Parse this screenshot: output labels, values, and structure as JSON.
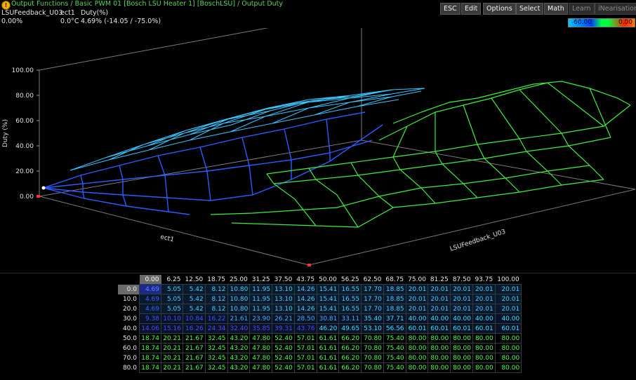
{
  "header": {
    "title": "Output Functions / Basic PWM 01 [Bosch LSU Heater 1] [BoschLSU] / Output Duty",
    "x_name": "LSUFeedback_U03",
    "x_value": "0.00%",
    "y_name": "ect1",
    "y_value": "0.0°C",
    "z_name": "Duty(%)",
    "z_value": "4.69% (-14.05 / -75.0%)"
  },
  "toolbar": {
    "esc": "ESC",
    "edit": "Edit",
    "options": "Options",
    "select": "Select",
    "math": "Math",
    "learn": "Learn",
    "linearisation": "iNearisation"
  },
  "scale": {
    "low": "-60.00",
    "high": "0.00"
  },
  "plot": {
    "z_axis_title": "Duty (%)",
    "z_ticks": [
      "100.00",
      "80.00",
      "60.00",
      "40.00",
      "20.00",
      "0.00"
    ],
    "y_axis_title": "ect1",
    "x_axis_title": "LSUFeedback_U03"
  },
  "table": {
    "columns": [
      "0.00",
      "6.25",
      "12.50",
      "18.75",
      "25.00",
      "31.25",
      "37.50",
      "43.75",
      "50.00",
      "56.25",
      "62.50",
      "68.75",
      "75.00",
      "81.25",
      "87.50",
      "93.75",
      "100.00"
    ],
    "rows": [
      "0.0",
      "10.0",
      "20.0",
      "30.0",
      "40.0",
      "50.0",
      "60.0",
      "70.0",
      "80.0"
    ],
    "values": [
      [
        "4.69",
        "5.05",
        "5.42",
        "8.12",
        "10.80",
        "11.95",
        "13.10",
        "14.26",
        "15.41",
        "16.55",
        "17.70",
        "18.85",
        "20.01",
        "20.01",
        "20.01",
        "20.01",
        "20.01"
      ],
      [
        "4.69",
        "5.05",
        "5.42",
        "8.12",
        "10.80",
        "11.95",
        "13.10",
        "14.26",
        "15.41",
        "16.55",
        "17.70",
        "18.85",
        "20.01",
        "20.01",
        "20.01",
        "20.01",
        "20.01"
      ],
      [
        "4.69",
        "5.05",
        "5.42",
        "8.12",
        "10.80",
        "11.95",
        "13.10",
        "14.26",
        "15.41",
        "16.55",
        "17.70",
        "18.85",
        "20.01",
        "20.01",
        "20.01",
        "20.01",
        "20.01"
      ],
      [
        "9.38",
        "10.10",
        "10.84",
        "16.22",
        "21.61",
        "23.90",
        "26.21",
        "28.50",
        "30.81",
        "33.11",
        "35.40",
        "37.71",
        "40.00",
        "40.00",
        "40.00",
        "40.00",
        "40.00"
      ],
      [
        "14.06",
        "15.16",
        "16.26",
        "24.34",
        "32.40",
        "35.85",
        "39.31",
        "43.76",
        "46.20",
        "49.65",
        "53.10",
        "56.56",
        "60.01",
        "60.01",
        "60.01",
        "60.01",
        "60.01"
      ],
      [
        "18.74",
        "20.21",
        "21.67",
        "32.45",
        "43.20",
        "47.80",
        "52.40",
        "57.01",
        "61.61",
        "66.20",
        "70.80",
        "75.40",
        "80.00",
        "80.00",
        "80.00",
        "80.00",
        "80.00"
      ],
      [
        "18.74",
        "20.21",
        "21.67",
        "32.45",
        "43.20",
        "47.80",
        "52.40",
        "57.01",
        "61.61",
        "66.20",
        "70.80",
        "75.40",
        "80.00",
        "80.00",
        "80.00",
        "80.00",
        "80.00"
      ],
      [
        "18.74",
        "20.21",
        "21.67",
        "32.45",
        "43.20",
        "47.80",
        "52.40",
        "57.01",
        "61.61",
        "66.20",
        "70.80",
        "75.40",
        "80.00",
        "80.00",
        "80.00",
        "80.00",
        "80.00"
      ],
      [
        "18.74",
        "20.21",
        "21.67",
        "32.45",
        "43.20",
        "47.80",
        "52.40",
        "57.01",
        "61.61",
        "66.20",
        "70.80",
        "75.40",
        "80.00",
        "80.00",
        "80.00",
        "80.00",
        "80.00"
      ]
    ]
  }
}
